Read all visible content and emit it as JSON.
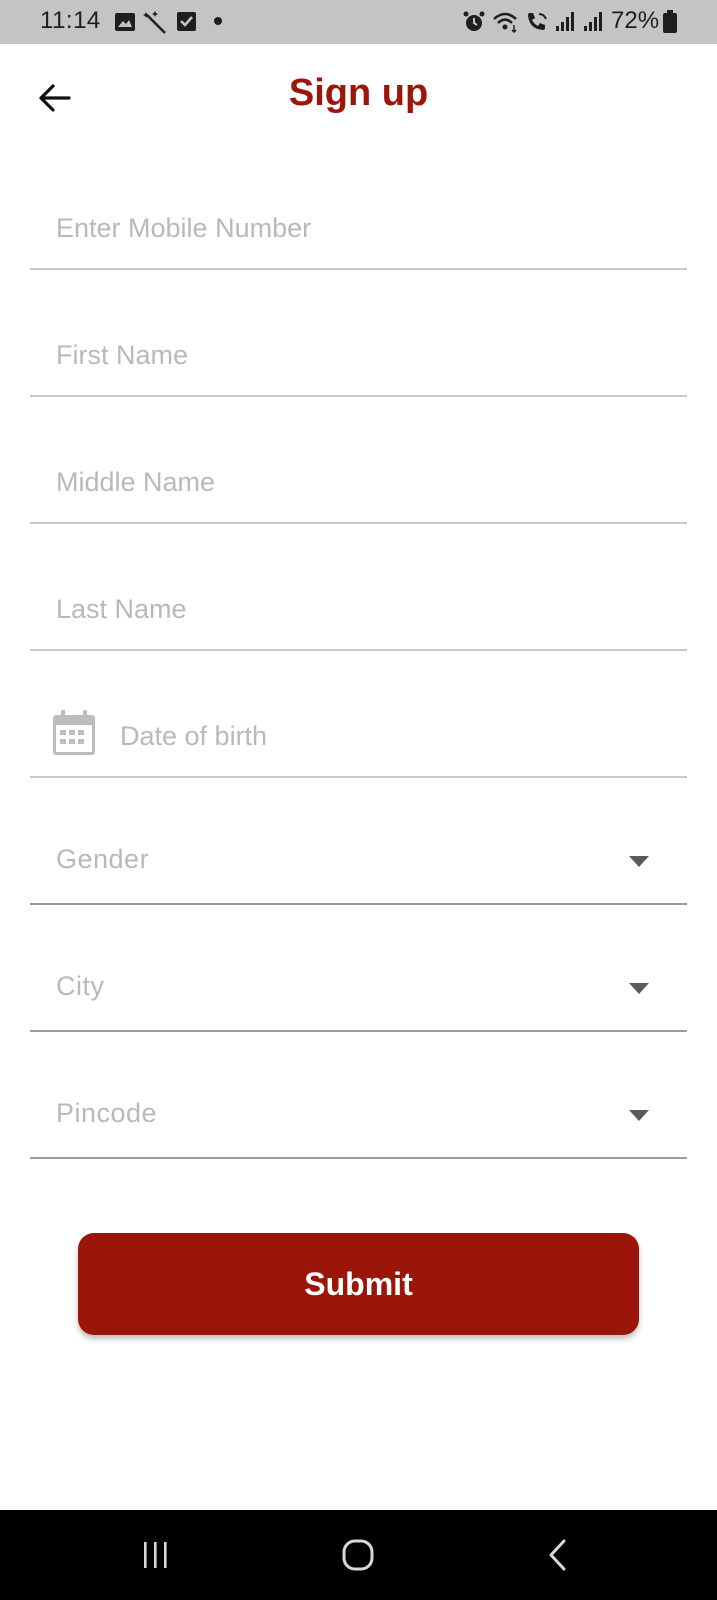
{
  "status_bar": {
    "time": "11:14",
    "battery": "72%",
    "icons": [
      "gallery-icon",
      "magic-wand-icon",
      "checkbox-icon",
      "notification-dot-icon",
      "alarm-icon",
      "wifi-icon",
      "wifi-calling-icon",
      "signal-icon",
      "signal-icon",
      "battery-icon"
    ]
  },
  "header": {
    "title": "Sign up",
    "back_icon": "arrow-left-icon"
  },
  "form": {
    "mobile_placeholder": "Enter Mobile Number",
    "first_name_placeholder": "First Name",
    "middle_name_placeholder": "Middle Name",
    "last_name_placeholder": "Last Name",
    "dob_placeholder": "Date of birth",
    "dob_icon": "calendar-icon",
    "gender_label": "Gender",
    "city_label": "City",
    "pincode_label": "Pincode",
    "dropdown_icon": "caret-down-icon"
  },
  "submit_label": "Submit",
  "nav_bar": {
    "buttons": [
      "recent-apps-icon",
      "home-icon",
      "back-icon"
    ]
  },
  "colors": {
    "brand": "#9b1508",
    "placeholder": "#b9b9b9",
    "status_bar": "#c4c4c4",
    "nav_bar": "#000000"
  }
}
